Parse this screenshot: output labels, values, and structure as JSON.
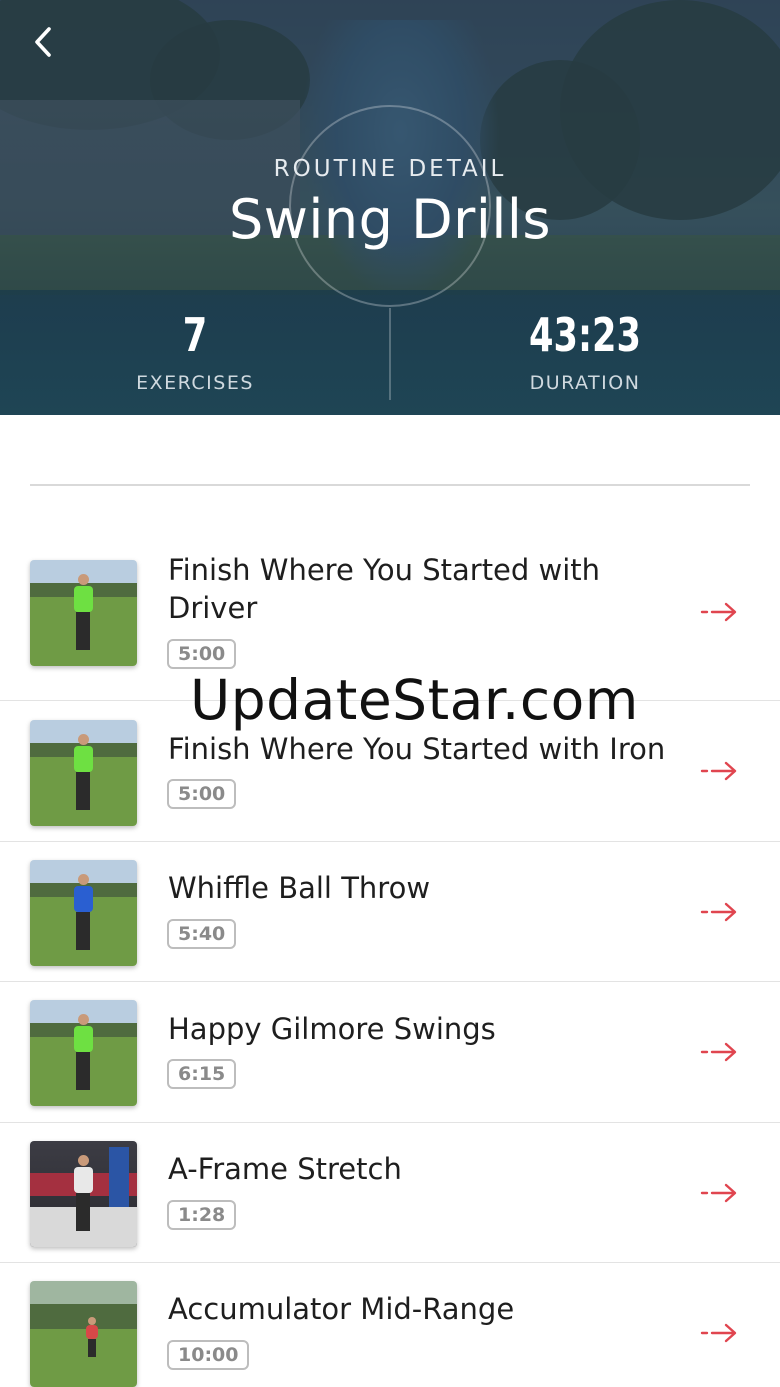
{
  "header": {
    "eyebrow": "ROUTINE DETAIL",
    "title": "Swing Drills",
    "back_icon": "chevron-left-icon"
  },
  "stats": {
    "exercises": {
      "value": "7",
      "label": "EXERCISES"
    },
    "duration": {
      "value": "43:23",
      "label": "DURATION"
    }
  },
  "exercises": [
    {
      "title": "Finish Where You Started with Driver",
      "duration": "5:00"
    },
    {
      "title": "Finish Where You Started with Iron",
      "duration": "5:00"
    },
    {
      "title": "Whiffle Ball Throw",
      "duration": "5:40"
    },
    {
      "title": "Happy Gilmore Swings",
      "duration": "6:15"
    },
    {
      "title": "A-Frame Stretch",
      "duration": "1:28"
    },
    {
      "title": "Accumulator Mid-Range",
      "duration": "10:00"
    }
  ],
  "watermark": "UpdateStar.com",
  "colors": {
    "accent_arrow": "#e0454f",
    "hero_tint": "#24404f",
    "text_primary": "#1e1e1e",
    "badge_border": "#bdbdbd"
  }
}
